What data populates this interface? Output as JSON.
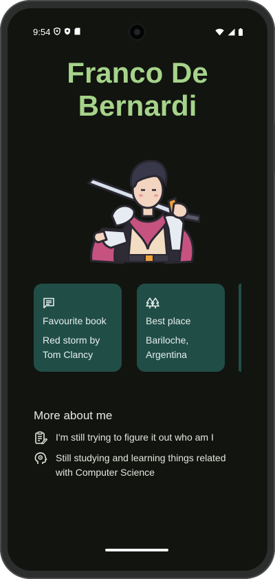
{
  "status_bar": {
    "time": "9:54",
    "left_icons": [
      "location-shield-icon",
      "vpn-shield-icon",
      "sd-card-icon"
    ],
    "right_icons": [
      "wifi-icon",
      "signal-icon",
      "battery-icon"
    ]
  },
  "profile": {
    "name_line1": "Franco De",
    "name_line2": "Bernardi",
    "name_color": "#a6d38a",
    "avatar_icon": "knight-with-sword-avatar"
  },
  "cards": [
    {
      "icon": "message-icon",
      "title": "Favourite book",
      "value": "Red storm by Tom Clancy"
    },
    {
      "icon": "forest-icon",
      "title": "Best place",
      "value": "Bariloche, Argentina"
    }
  ],
  "card_color": "#214d47",
  "about": {
    "title": "More about me",
    "items": [
      {
        "icon": "clipboard-edit-icon",
        "text": "I'm still trying to figure it out who am I"
      },
      {
        "icon": "psychology-icon",
        "text": "Still studying and learning things related with Computer Science"
      }
    ]
  }
}
